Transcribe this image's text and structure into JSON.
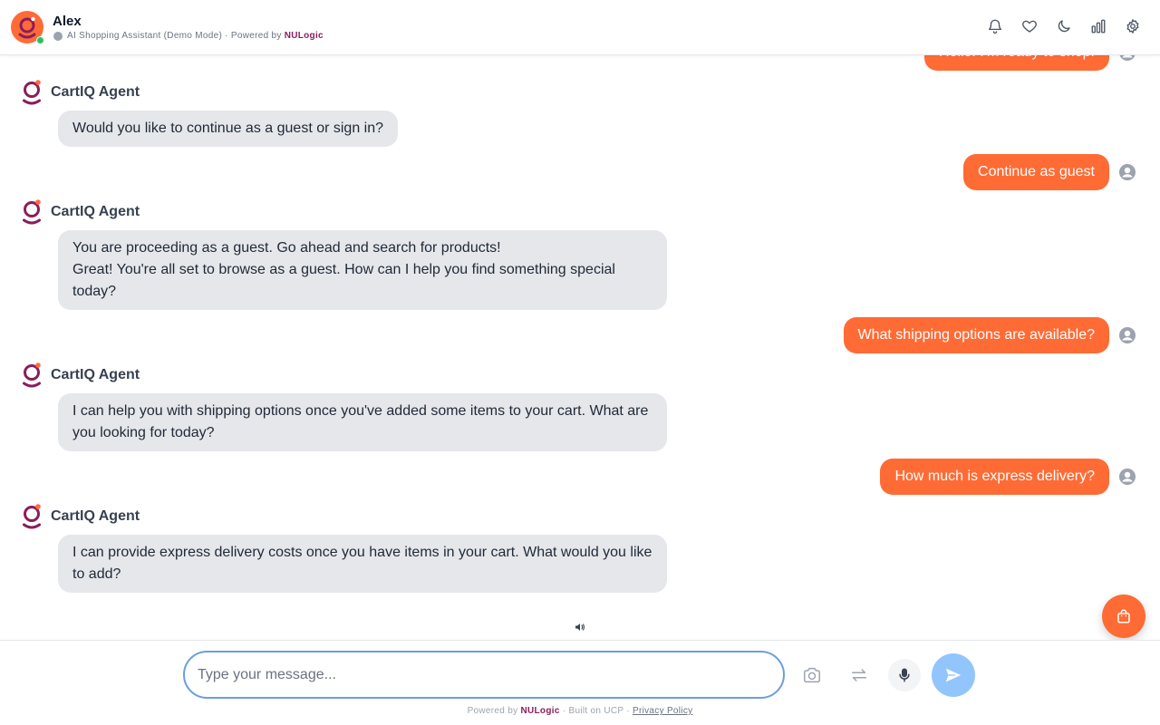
{
  "header": {
    "name": "Alex",
    "subtitle": "AI Shopping Assistant (Demo Mode) · Powered by",
    "brand": "NULogic",
    "icons": [
      "bell-icon",
      "heart-icon",
      "moon-icon",
      "bar-chart-icon",
      "gear-icon"
    ]
  },
  "messages": {
    "m0": {
      "text": "Hello! I'm ready to shop!"
    },
    "m1": {
      "agent": "CartIQ Agent",
      "text": "Would you like to continue as a guest or sign in?"
    },
    "m2": {
      "text": "Continue as guest"
    },
    "m3": {
      "agent": "CartIQ Agent",
      "line1": "You are proceeding as a guest. Go ahead and search for products!",
      "line2": "Great! You're all set to browse as a guest. How can I help you find something special today?"
    },
    "m4": {
      "text": "What shipping options are available?"
    },
    "m5": {
      "agent": "CartIQ Agent",
      "text": "I can help you with shipping options once you've added some items to your cart. What are you looking for today?"
    },
    "m6": {
      "text": "How much is express delivery?"
    },
    "m7": {
      "agent": "CartIQ Agent",
      "text": "I can provide express delivery costs once you have items in your cart. What would you like to add?"
    }
  },
  "input": {
    "placeholder": "Type your message..."
  },
  "footer": {
    "powered": "Powered by",
    "brand": "NULogic",
    "built": "· Built on UCP ·",
    "privacy": "Privacy Policy"
  },
  "colors": {
    "accent": "#ff6b35",
    "brand": "#8b1d5c",
    "agent_bubble": "#e5e7eb",
    "send_button": "#93c5fd",
    "online": "#22c55e"
  }
}
